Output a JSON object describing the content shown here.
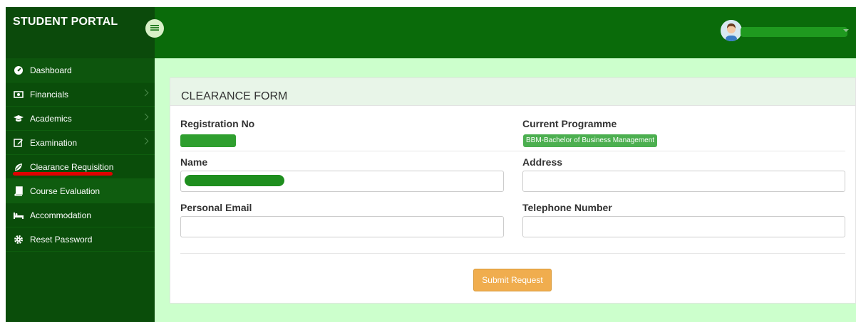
{
  "brand": {
    "title": "STUDENT PORTAL"
  },
  "sidebar": {
    "items": [
      {
        "label": "Dashboard",
        "icon": "dashboard-icon",
        "has_chevron": false
      },
      {
        "label": "Financials",
        "icon": "money-icon",
        "has_chevron": true
      },
      {
        "label": "Academics",
        "icon": "graduation-cap-icon",
        "has_chevron": true
      },
      {
        "label": "Examination",
        "icon": "edit-icon",
        "has_chevron": true
      },
      {
        "label": "Clearance Requisition",
        "icon": "leaf-icon",
        "has_chevron": false
      },
      {
        "label": "Course Evaluation",
        "icon": "book-icon",
        "has_chevron": false
      },
      {
        "label": "Accommodation",
        "icon": "bed-icon",
        "has_chevron": false
      },
      {
        "label": "Reset Password",
        "icon": "gear-icon",
        "has_chevron": false
      }
    ]
  },
  "form": {
    "title": "CLEARANCE FORM",
    "registration_label": "Registration No",
    "programme_label": "Current Programme",
    "programme_value": "BBM-Bachelor of Business Management",
    "name_label": "Name",
    "address_label": "Address",
    "email_label": "Personal Email",
    "phone_label": "Telephone Number",
    "submit_label": "Submit Request"
  },
  "colors": {
    "sidebar_bg": "#0a4d0a",
    "topbar_bg": "#0a6b0a",
    "content_bg": "#ccffcc",
    "badge_bg": "#4caf50",
    "submit_bg": "#f0ad4e",
    "annotation_red": "#e00000"
  }
}
